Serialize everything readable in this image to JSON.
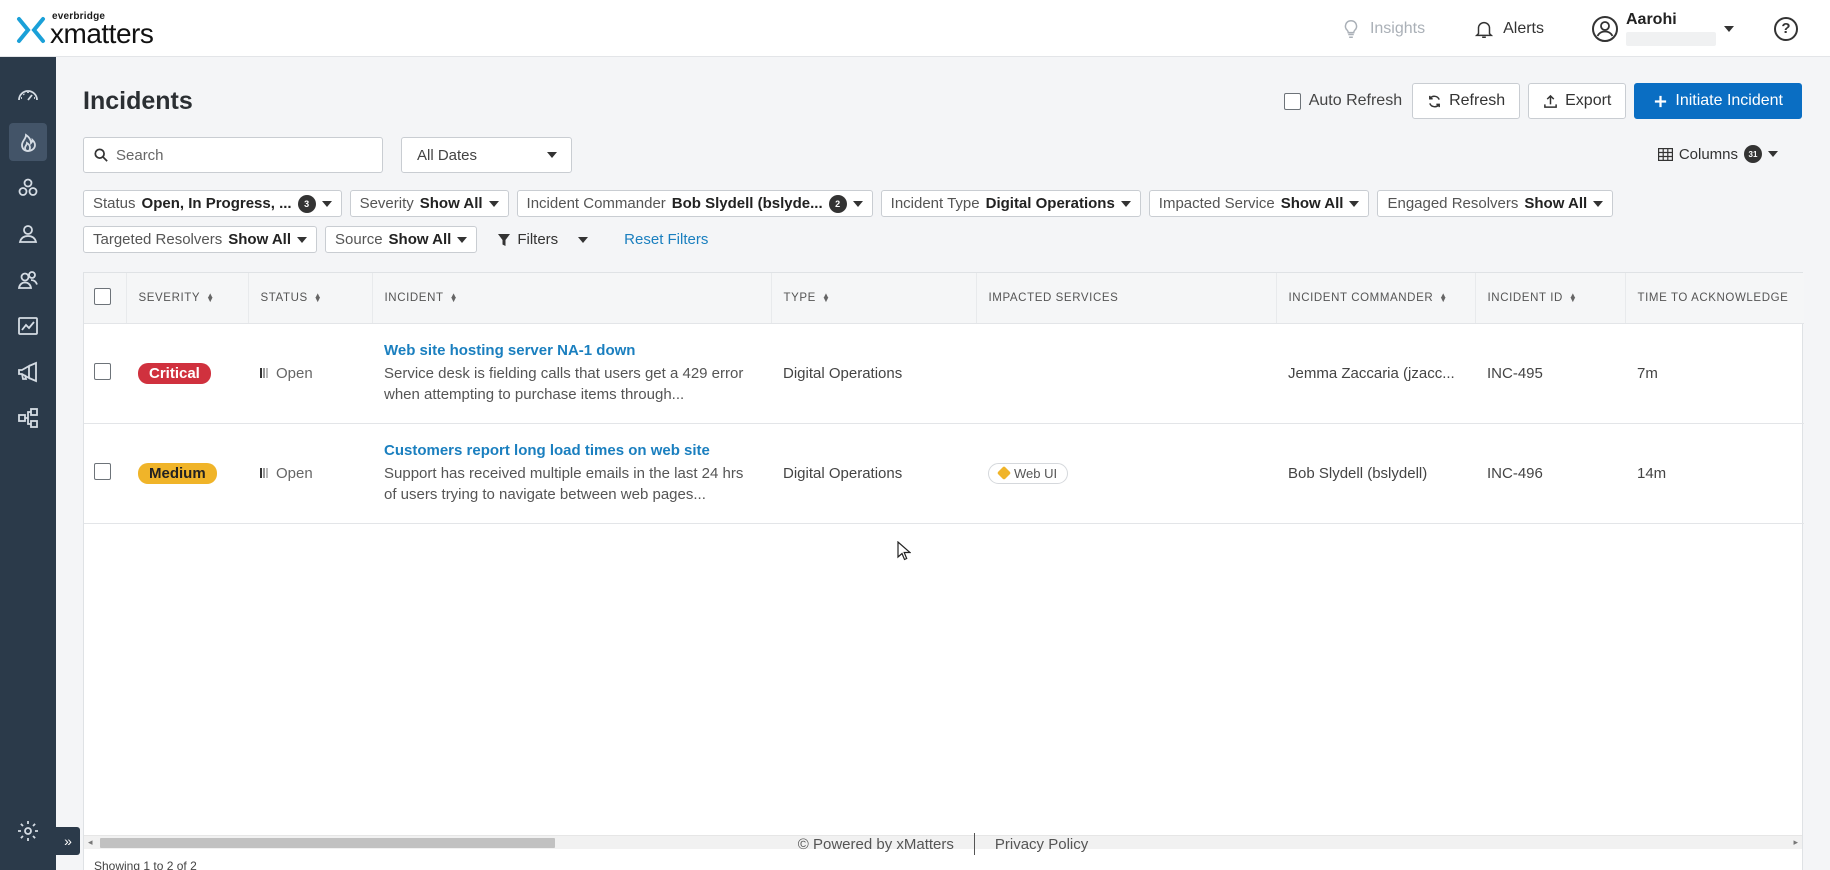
{
  "brand": {
    "sub": "everbridge",
    "name": "xmatters"
  },
  "topbar": {
    "insights": "Insights",
    "alerts": "Alerts",
    "user_name": "Aarohi",
    "help": "?"
  },
  "page": {
    "title": "Incidents",
    "auto_refresh": "Auto Refresh",
    "refresh": "Refresh",
    "export": "Export",
    "initiate": "Initiate Incident",
    "search_placeholder": "Search",
    "dates": "All Dates",
    "columns_label": "Columns",
    "columns_count": "31"
  },
  "filters": {
    "row1": [
      {
        "label": "Status",
        "value": "Open, In Progress, ...",
        "badge": "3"
      },
      {
        "label": "Severity",
        "value": "Show All",
        "badge": ""
      },
      {
        "label": "Incident Commander",
        "value": "Bob Slydell (bslyde...",
        "badge": "2"
      },
      {
        "label": "Incident Type",
        "value": "Digital Operations",
        "badge": ""
      },
      {
        "label": "Impacted Service",
        "value": "Show All",
        "badge": ""
      },
      {
        "label": "Engaged Resolvers",
        "value": "Show All",
        "badge": ""
      }
    ],
    "row2": [
      {
        "label": "Targeted Resolvers",
        "value": "Show All"
      },
      {
        "label": "Source",
        "value": "Show All"
      }
    ],
    "filters_button": "Filters",
    "reset": "Reset Filters"
  },
  "table": {
    "headers": {
      "severity": "SEVERITY",
      "status": "STATUS",
      "incident": "INCIDENT",
      "type": "TYPE",
      "impacted": "IMPACTED SERVICES",
      "commander": "INCIDENT COMMANDER",
      "id": "INCIDENT ID",
      "tta": "TIME TO ACKNOWLEDGE"
    },
    "rows": [
      {
        "severity": "Critical",
        "status": "Open",
        "title": "Web site hosting server NA-1 down",
        "desc": "Service desk is fielding calls that users get a 429 error when attempting to purchase items through...",
        "type": "Digital Operations",
        "service": "",
        "commander": "Jemma Zaccaria (jzacc...",
        "id": "INC-495",
        "tta": "7m"
      },
      {
        "severity": "Medium",
        "status": "Open",
        "title": "Customers report long load times on web site",
        "desc": "Support has received multiple emails in the last 24 hrs of users trying to navigate between web pages...",
        "type": "Digital Operations",
        "service": "Web UI",
        "commander": "Bob Slydell (bslydell)",
        "id": "INC-496",
        "tta": "14m"
      }
    ],
    "showing": "Showing 1 to 2 of 2"
  },
  "footer": {
    "powered": "© Powered by xMatters",
    "privacy": "Privacy Policy"
  },
  "colors": {
    "primary": "#0a6ec3",
    "sidebar": "#2b3a4a",
    "critical": "#d0313e",
    "medium": "#f0b429",
    "link": "#1a7fbf"
  }
}
